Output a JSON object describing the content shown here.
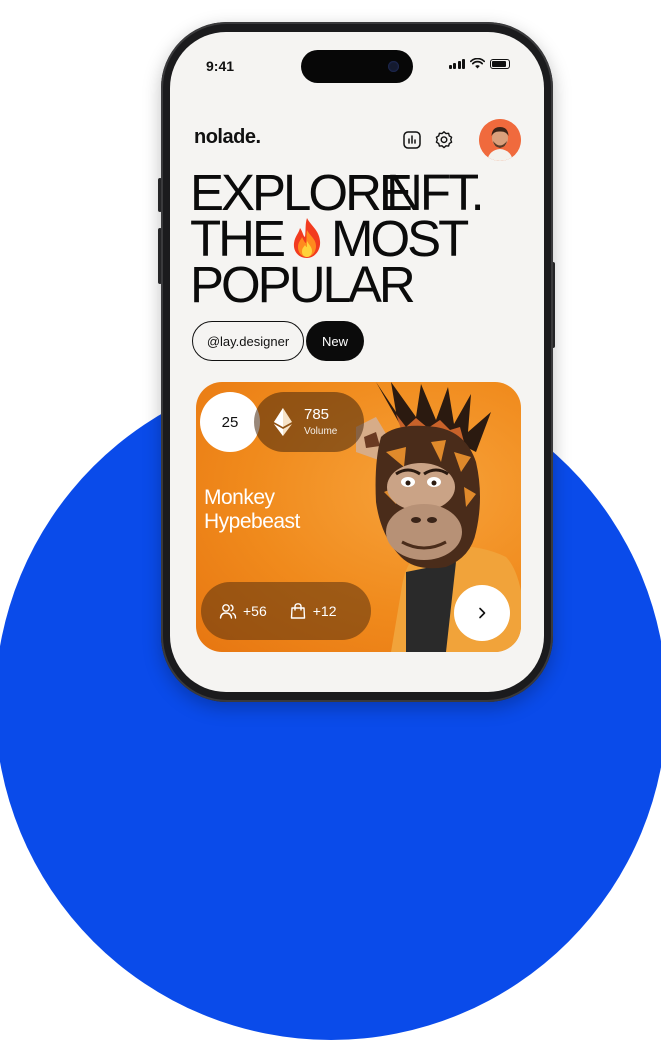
{
  "status_bar": {
    "time": "9:41"
  },
  "header": {
    "brand": "nolade."
  },
  "hero": {
    "line1": "EXPLORE",
    "line2a": "THE",
    "line2b": "MOST",
    "line3": "POPULAR",
    "line4": "NFT."
  },
  "tags": {
    "handle": "@lay.designer",
    "new_label": "New"
  },
  "card": {
    "count": "25",
    "volume_value": "785",
    "volume_label": "Volume",
    "title_line1": "Monkey",
    "title_line2": "Hypebeast",
    "followers": "+56",
    "bags": "+12"
  },
  "colors": {
    "accent_blue": "#0a4bea",
    "card_orange": "#f08a1c",
    "avatar_bg": "#f06a3d"
  },
  "icons": [
    "stats-icon",
    "gear-icon",
    "fire-icon",
    "ethereum-icon",
    "users-icon",
    "bag-icon",
    "chevron-right-icon"
  ]
}
